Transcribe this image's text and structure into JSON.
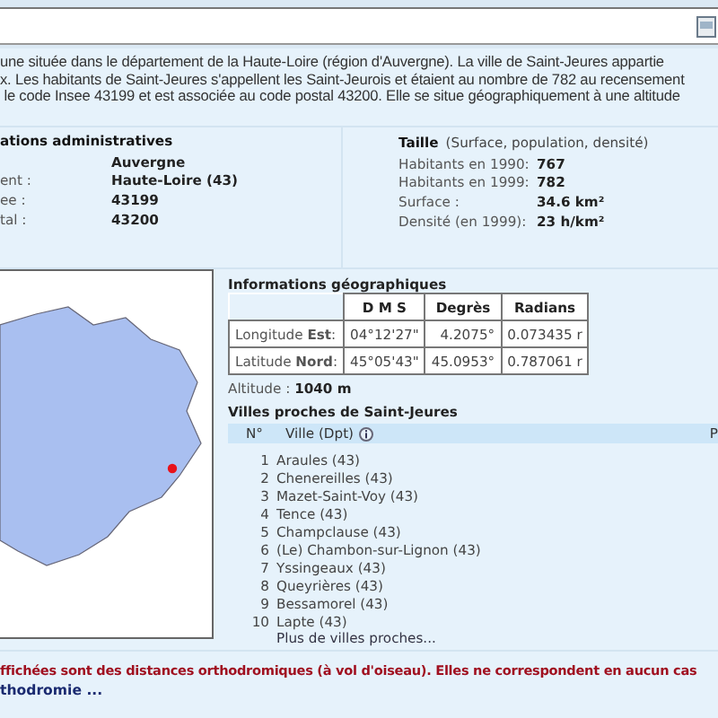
{
  "intro": {
    "lines": [
      "une située dans le département de la Haute-Loire (région d'Auvergne). La ville de Saint-Jeures appartie",
      "x. Les habitants de Saint-Jeures s'appellent les Saint-Jeurois et étaient au nombre de 782 au recensement",
      " le code Insee 43199 et est associée au code postal 43200. Elle se situe géographiquement à une altitude"
    ]
  },
  "admin": {
    "title": "ations administratives",
    "rows": [
      {
        "value": "Auvergne"
      },
      {
        "label": "ent :",
        "value": "Haute-Loire (43)"
      },
      {
        "label": "ee :",
        "value": "43199"
      },
      {
        "label": "tal :",
        "value": "43200"
      }
    ]
  },
  "taille": {
    "title": "Taille",
    "subtitle": "(Surface, population, densité)",
    "rows": [
      {
        "label": "Habitants en 1990:",
        "value": "767"
      },
      {
        "label": "Habitants en 1999:",
        "value": "782"
      },
      {
        "label": "Surface :",
        "value": "34.6 km²"
      },
      {
        "label": "Densité (en 1999):",
        "value": "23 h/km²"
      }
    ]
  },
  "geo": {
    "title": "Informations géographiques",
    "columns": [
      "D M S",
      "Degrès",
      "Radians"
    ],
    "rows": [
      {
        "label": "Longitude **Est**:",
        "cells": [
          "04°12'27\"",
          "4.2075°",
          "0.073435 r"
        ]
      },
      {
        "label": "Latitude **Nord**:",
        "cells": [
          "45°05'43\"",
          "45.0953°",
          "0.787061 r"
        ]
      }
    ],
    "altitude_label": "Altitude :",
    "altitude": "1040 m"
  },
  "nearby": {
    "title": "Villes proches de Saint-Jeures",
    "columns": [
      "N°",
      "Ville (Dpt)",
      "P"
    ],
    "rows": [
      {
        "number": "1",
        "name": "Araules (43)"
      },
      {
        "number": "2",
        "name": "Chenereilles (43)"
      },
      {
        "number": "3",
        "name": "Mazet-Saint-Voy (43)"
      },
      {
        "number": "4",
        "name": "Tence (43)"
      },
      {
        "number": "5",
        "name": "Champclause (43)"
      },
      {
        "number": "6",
        "name": "(Le) Chambon-sur-Lignon (43)"
      },
      {
        "number": "7",
        "name": "Yssingeaux (43)"
      },
      {
        "number": "8",
        "name": "Queyrières (43)"
      },
      {
        "number": "9",
        "name": "Bessamorel (43)"
      },
      {
        "number": "10",
        "name": "Lapte (43)"
      }
    ],
    "more_link": "Plus de villes proches..."
  },
  "footer": {
    "warning": "ffichées sont des distances orthodromiques (à vol d'oiseau). Elles ne correspondent en aucun cas",
    "link": "thodromie ..."
  }
}
